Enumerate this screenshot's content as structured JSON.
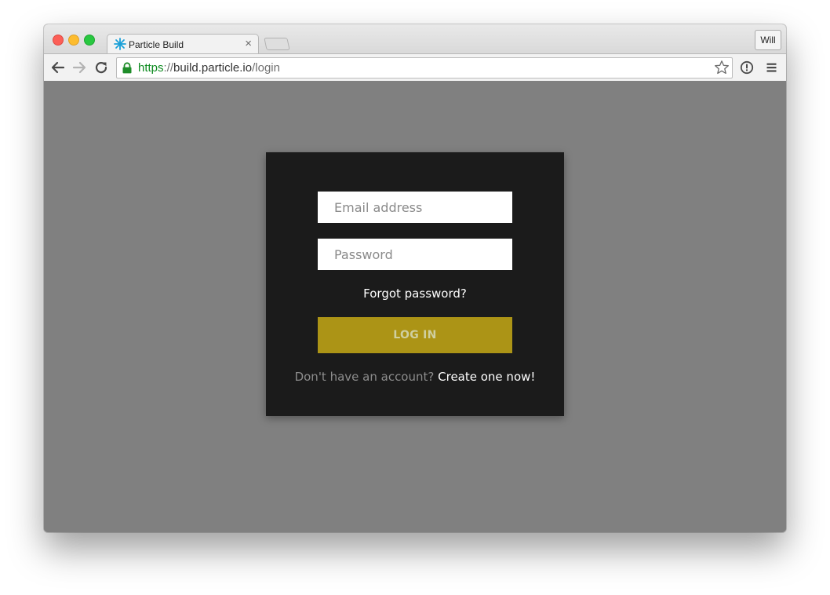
{
  "browser": {
    "tab": {
      "title": "Particle Build",
      "close_glyph": "×",
      "favicon": "particle-star-icon"
    },
    "profile_label": "Will",
    "url": {
      "scheme": "https",
      "separator": "://",
      "host": "build.particle.io",
      "path": "/login"
    },
    "icons": {
      "back": "back-arrow-icon",
      "forward": "forward-arrow-icon",
      "reload": "reload-icon",
      "lock": "lock-icon",
      "bookmark": "star-icon",
      "extension": "info-icon",
      "menu": "hamburger-menu-icon"
    }
  },
  "login": {
    "email_placeholder": "Email address",
    "password_placeholder": "Password",
    "forgot_link": "Forgot password?",
    "login_button": "LOG IN",
    "signup_prompt": "Don't have an account?",
    "signup_link": "Create one now!"
  },
  "colors": {
    "page_background": "#808080",
    "card_background": "#1b1b1b",
    "accent_button": "#ac9416",
    "secure_scheme": "#0b8a1e"
  }
}
